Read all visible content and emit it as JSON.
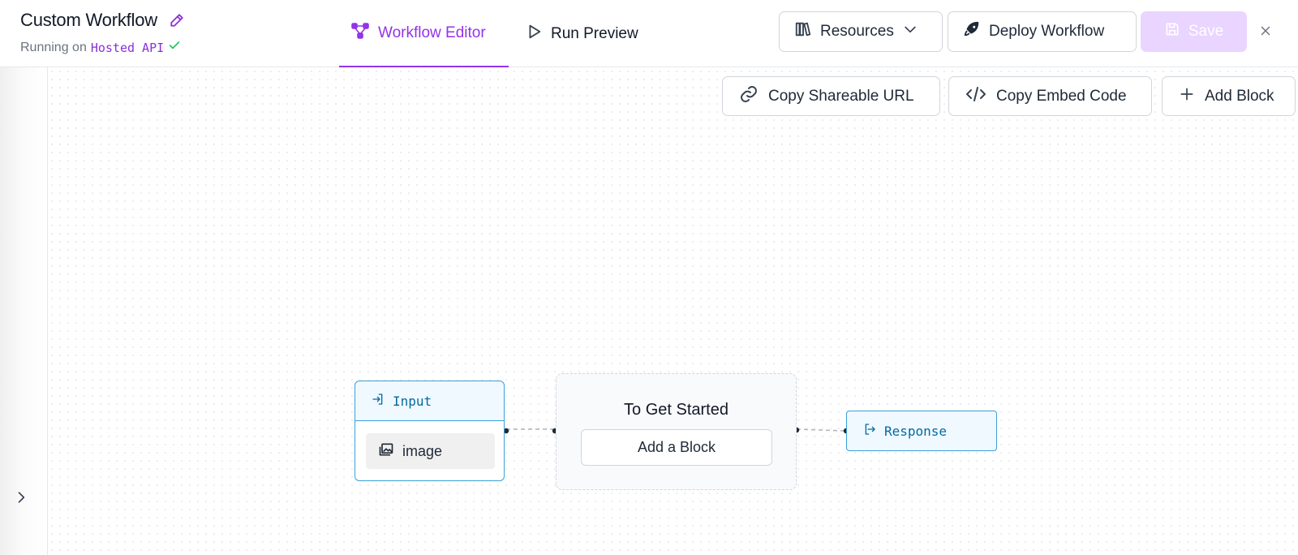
{
  "header": {
    "title": "Custom Workflow",
    "running_prefix": "Running on",
    "running_target": "Hosted API"
  },
  "tabs": [
    {
      "label": "Workflow Editor",
      "active": true
    },
    {
      "label": "Run Preview",
      "active": false
    }
  ],
  "toolbar": {
    "resources_label": "Resources",
    "deploy_label": "Deploy Workflow",
    "save_label": "Save"
  },
  "canvas_toolbar": {
    "copy_url_label": "Copy Shareable URL",
    "copy_embed_label": "Copy Embed Code",
    "add_block_label": "Add Block"
  },
  "nodes": {
    "input": {
      "title": "Input",
      "field": "image"
    },
    "start": {
      "title": "To Get Started",
      "button": "Add a Block"
    },
    "response": {
      "title": "Response"
    }
  },
  "icons": {
    "edit": "pencil-icon",
    "check": "check-icon",
    "workflow": "workflow-icon",
    "run": "play-icon",
    "resources": "books-icon",
    "dropdown": "chevron-down-icon",
    "deploy": "rocket-icon",
    "save": "floppy-icon",
    "close": "close-icon",
    "link": "link-icon",
    "embed": "code-icon",
    "add": "plus-icon",
    "input": "login-icon",
    "image": "image-icon",
    "response": "logout-icon",
    "expand": "chevron-right-icon"
  },
  "colors": {
    "accent": "#9333ea",
    "accent_light": "#e9d5ff",
    "node_border": "#3b9fd6",
    "node_text": "#0369a1",
    "success": "#22c55e"
  }
}
